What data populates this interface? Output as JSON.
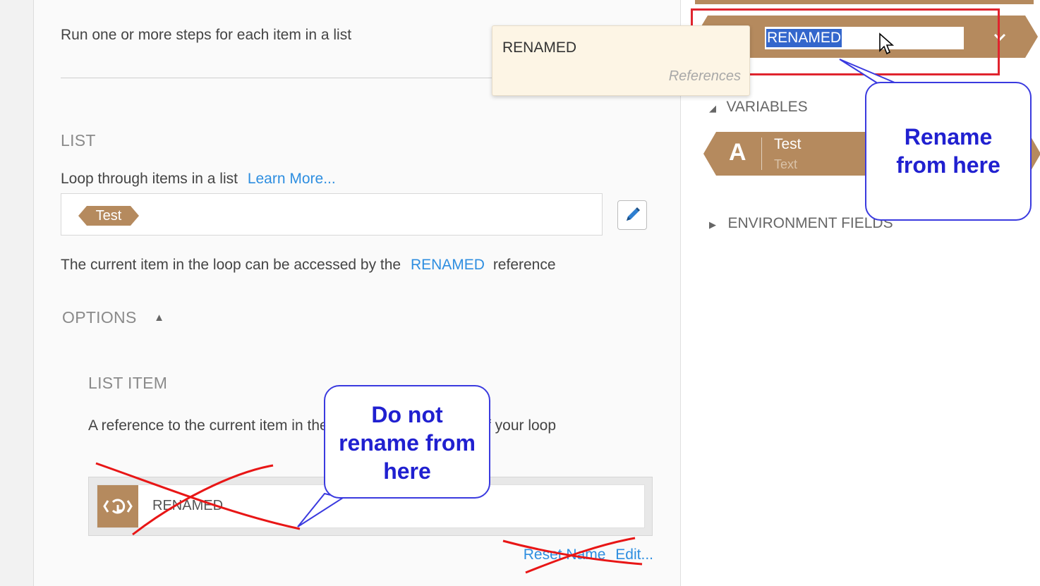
{
  "main": {
    "description": "Run one or more steps for each item in a list",
    "list_section": {
      "heading": "LIST",
      "loop_label": "Loop through items in a list",
      "learn_more": "Learn More...",
      "selected_tag": "Test"
    },
    "current_item": {
      "prefix": "The current item in the loop can be accessed by the",
      "reference": "RENAMED",
      "suffix": "reference"
    },
    "options": {
      "label": "OPTIONS"
    },
    "list_item": {
      "heading": "LIST ITEM",
      "description": "A reference to the current item in the list to use in the steps of your loop",
      "reference_name": "RENAMED",
      "reset_link": "Reset Name",
      "edit_link": "Edit..."
    }
  },
  "tooltip": {
    "title": "RENAMED",
    "subtitle": "References"
  },
  "right_panel": {
    "rename_value": "RENAMED",
    "variables_label": "VARIABLES",
    "variable": {
      "icon_letter": "A",
      "name": "Test",
      "type": "Text"
    },
    "environment_label": "ENVIRONMENT FIELDS"
  },
  "annotations": {
    "do_not_rename": [
      "Do not",
      "rename from",
      "here"
    ],
    "rename_here": [
      "Rename",
      "from here"
    ]
  },
  "colors": {
    "brand_tan": "#b58a5e",
    "link_blue": "#2e8ee0",
    "annotation_blue": "#2020d0",
    "annotation_red": "#e0242e",
    "tooltip_bg": "#fdf5e5"
  }
}
